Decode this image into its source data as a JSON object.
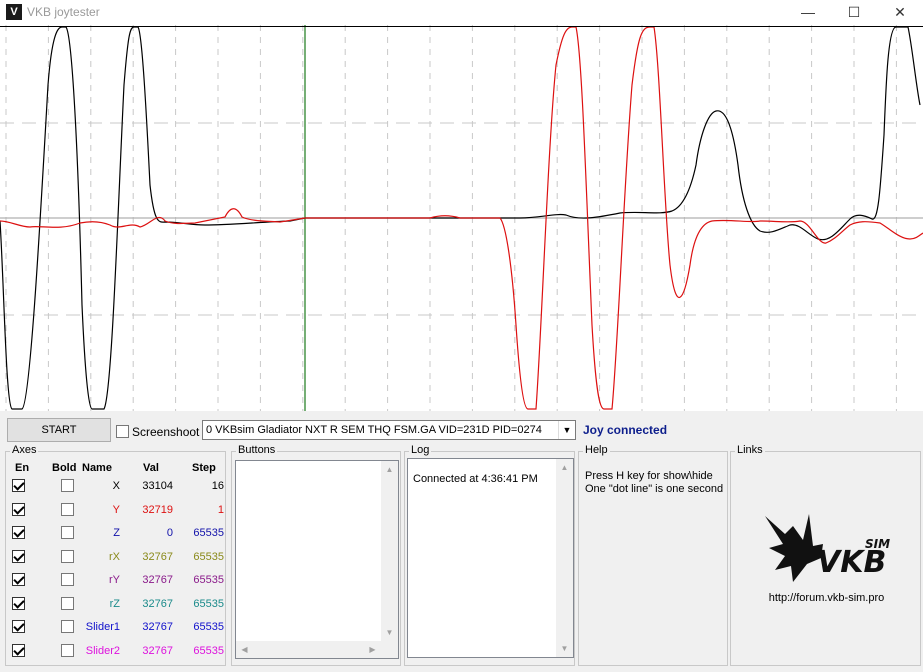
{
  "window": {
    "title": "VKB joytester",
    "icon_glyph": "V",
    "minimize_glyph": "—",
    "maximize_glyph": "☐",
    "close_glyph": "✕"
  },
  "plot": {
    "background": "#ffffff",
    "grid_color": "#c8c8c8",
    "cursor_color": "#1a7a1a",
    "series": [
      {
        "color": "#000000"
      },
      {
        "color": "#dd1111"
      }
    ]
  },
  "controls": {
    "start_label": "START",
    "screenshot_label": "Screenshoot",
    "screenshot_checked": false,
    "device": "0  VKBsim Gladiator NXT R SEM THQ  FSM.GA  VID=231D PID=0274",
    "status": "Joy connected"
  },
  "axes": {
    "title": "Axes",
    "headers": {
      "en": "En",
      "bold": "Bold",
      "name": "Name",
      "val": "Val",
      "step": "Step"
    },
    "rows": [
      {
        "name": "X",
        "val": "33104",
        "step": "16",
        "color": "#000000",
        "enabled": true,
        "bold": false
      },
      {
        "name": "Y",
        "val": "32719",
        "step": "1",
        "color": "#dd1111",
        "enabled": true,
        "bold": false
      },
      {
        "name": "Z",
        "val": "0",
        "step": "65535",
        "color": "#1111aa",
        "enabled": true,
        "bold": false
      },
      {
        "name": "rX",
        "val": "32767",
        "step": "65535",
        "color": "#8a8a1a",
        "enabled": true,
        "bold": false
      },
      {
        "name": "rY",
        "val": "32767",
        "step": "65535",
        "color": "#8a1a8a",
        "enabled": true,
        "bold": false
      },
      {
        "name": "rZ",
        "val": "32767",
        "step": "65535",
        "color": "#1a8a8a",
        "enabled": true,
        "bold": false
      },
      {
        "name": "Slider1",
        "val": "32767",
        "step": "65535",
        "color": "#1111cc",
        "enabled": true,
        "bold": false
      },
      {
        "name": "Slider2",
        "val": "32767",
        "step": "65535",
        "color": "#dd11dd",
        "enabled": true,
        "bold": false
      }
    ]
  },
  "buttons": {
    "title": "Buttons"
  },
  "log": {
    "title": "Log",
    "lines": [
      "Connected at 4:36:41 PM"
    ]
  },
  "help": {
    "title": "Help",
    "line1": "Press H key for show\\hide",
    "line2": "One \"dot line\" is one second"
  },
  "links": {
    "title": "Links",
    "url": "http://forum.vkb-sim.pro",
    "logo_text": "VKB",
    "logo_sub": "SIM"
  }
}
